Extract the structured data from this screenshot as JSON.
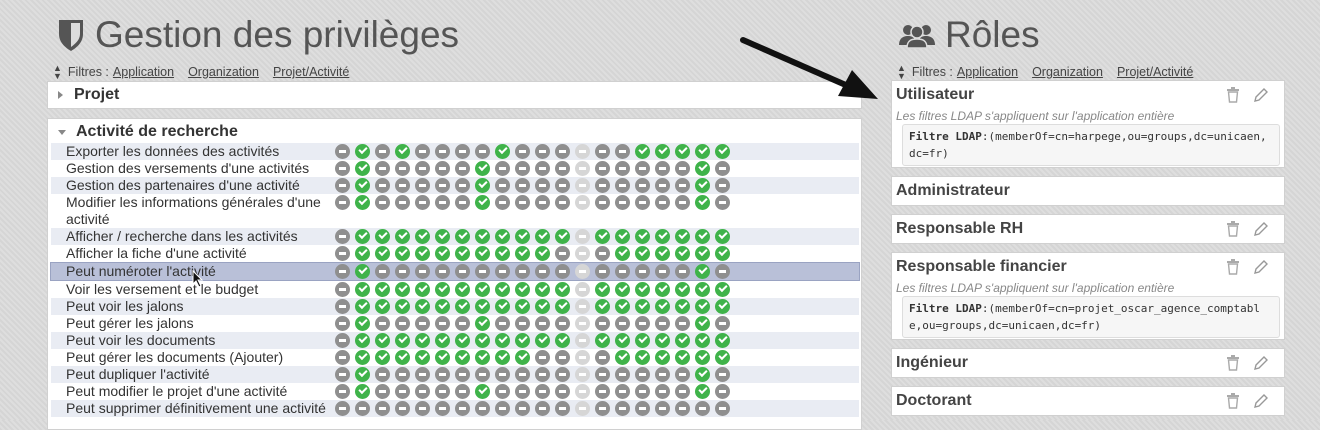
{
  "privileges": {
    "title": "Gestion des privilèges",
    "filters_label": "Filtres :",
    "filters": [
      "Application",
      "Organization",
      "Projet/Activité"
    ],
    "groups": [
      {
        "label": "Projet",
        "expanded": false
      },
      {
        "label": "Activité de recherche",
        "expanded": true
      }
    ],
    "rows": [
      {
        "label": "Exporter les données des activités",
        "cells": "nynynnnnynnndnnyyyyy"
      },
      {
        "label": "Gestion des versements d'une activités",
        "cells": "nynnnnnynnnndnnnnnyn"
      },
      {
        "label": "Gestion des partenaires d'une activité",
        "cells": "nynnnnnynnnndnnnnnyn"
      },
      {
        "label": "Modifier les informations générales d'une activité",
        "cells": "nynnnnnynnnndnnnnnyn"
      },
      {
        "label": "Afficher / recherche dans les activités",
        "cells": "nyyyyyyyyyyydyyyyyyy"
      },
      {
        "label": "Afficher la fiche d'une activité",
        "cells": "nyyyyyyyyyyndnyyyyyy"
      },
      {
        "label": "Peut numéroter l'activité",
        "cells": "nynnnnnnnnnndnnnnnyn"
      },
      {
        "label": "Voir les versement et le budget",
        "cells": "nyyyyyyyyyyydyyyyyyy"
      },
      {
        "label": "Peut voir les jalons",
        "cells": "nyyyyyyyyyyydyyyyyyy"
      },
      {
        "label": "Peut gérer les jalons",
        "cells": "nynnnnnynnnndnnnnnyn"
      },
      {
        "label": "Peut voir les documents",
        "cells": "nyyyyyyyyyyydyyyyyyy"
      },
      {
        "label": "Peut gérer les documents (Ajouter)",
        "cells": "nyyyyyyyyynndnyyyyyy"
      },
      {
        "label": "Peut dupliquer l'activité",
        "cells": "nynnnnnnnnnndnnnnnyn"
      },
      {
        "label": "Peut modifier le projet d'une activité",
        "cells": "nynnnnnynnnndnnnnnyn"
      },
      {
        "label": "Peut supprimer définitivement une activité",
        "cells": "nnnnnnnnnnnndnnnnnnn"
      }
    ]
  },
  "roles": {
    "title": "Rôles",
    "filters_label": "Filtres :",
    "filters": [
      "Application",
      "Organization",
      "Projet/Activité"
    ],
    "items": [
      {
        "name": "Utilisateur",
        "note": "Les filtres LDAP s'appliquent sur l'application entière",
        "ldap_label": "Filtre LDAP",
        "ldap": ":(memberOf=cn=harpege,ou=groups,dc=unicaen,dc=fr)",
        "actions": true
      },
      {
        "name": "Administrateur",
        "actions": false
      },
      {
        "name": "Responsable RH",
        "actions": true
      },
      {
        "name": "Responsable financier",
        "note": "Les filtres LDAP s'appliquent sur l'application entière",
        "ldap_label": "Filtre LDAP",
        "ldap": ":(memberOf=cn=projet_oscar_agence_comptable,ou=groups,dc=unicaen,dc=fr)",
        "actions": true
      },
      {
        "name": "Ingénieur",
        "actions": true
      },
      {
        "name": "Doctorant",
        "actions": true
      }
    ]
  },
  "colors": {
    "granted": "#3fb34a",
    "denied": "#8f8f8f",
    "disabled": "#d6d6d6",
    "selected_row": "#b9c0d8"
  }
}
